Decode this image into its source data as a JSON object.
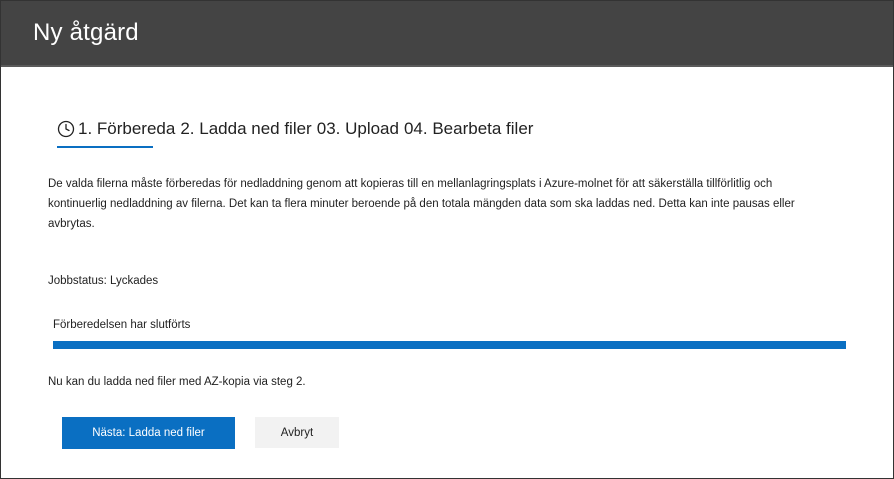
{
  "header": {
    "title": "Ny åtgärd"
  },
  "steps": {
    "icon": "clock-icon",
    "items": [
      {
        "label": "1. Förbereda"
      },
      {
        "label": "2. Ladda ned filer"
      },
      {
        "label": "03. Upload"
      },
      {
        "label": "04. Bearbeta filer"
      }
    ],
    "active_index": 0
  },
  "description": "De valda filerna måste förberedas för nedladdning genom att kopieras till en mellanlagringsplats i Azure-molnet för att säkerställa tillförlitlig och kontinuerlig nedladdning av filerna. Det kan ta flera minuter beroende på den totala mängden data som ska laddas ned. Detta kan inte pausas eller avbrytas.",
  "job_status": "Jobbstatus: Lyckades",
  "progress": {
    "label": "Förberedelsen har slutförts",
    "percent": 100
  },
  "hint": "Nu kan du ladda ned filer med AZ-kopia via steg 2.",
  "buttons": {
    "next_label": "Nästa: Ladda ned filer",
    "cancel_label": "Avbryt"
  },
  "colors": {
    "header_bg": "#444444",
    "accent": "#0a6fc2"
  }
}
